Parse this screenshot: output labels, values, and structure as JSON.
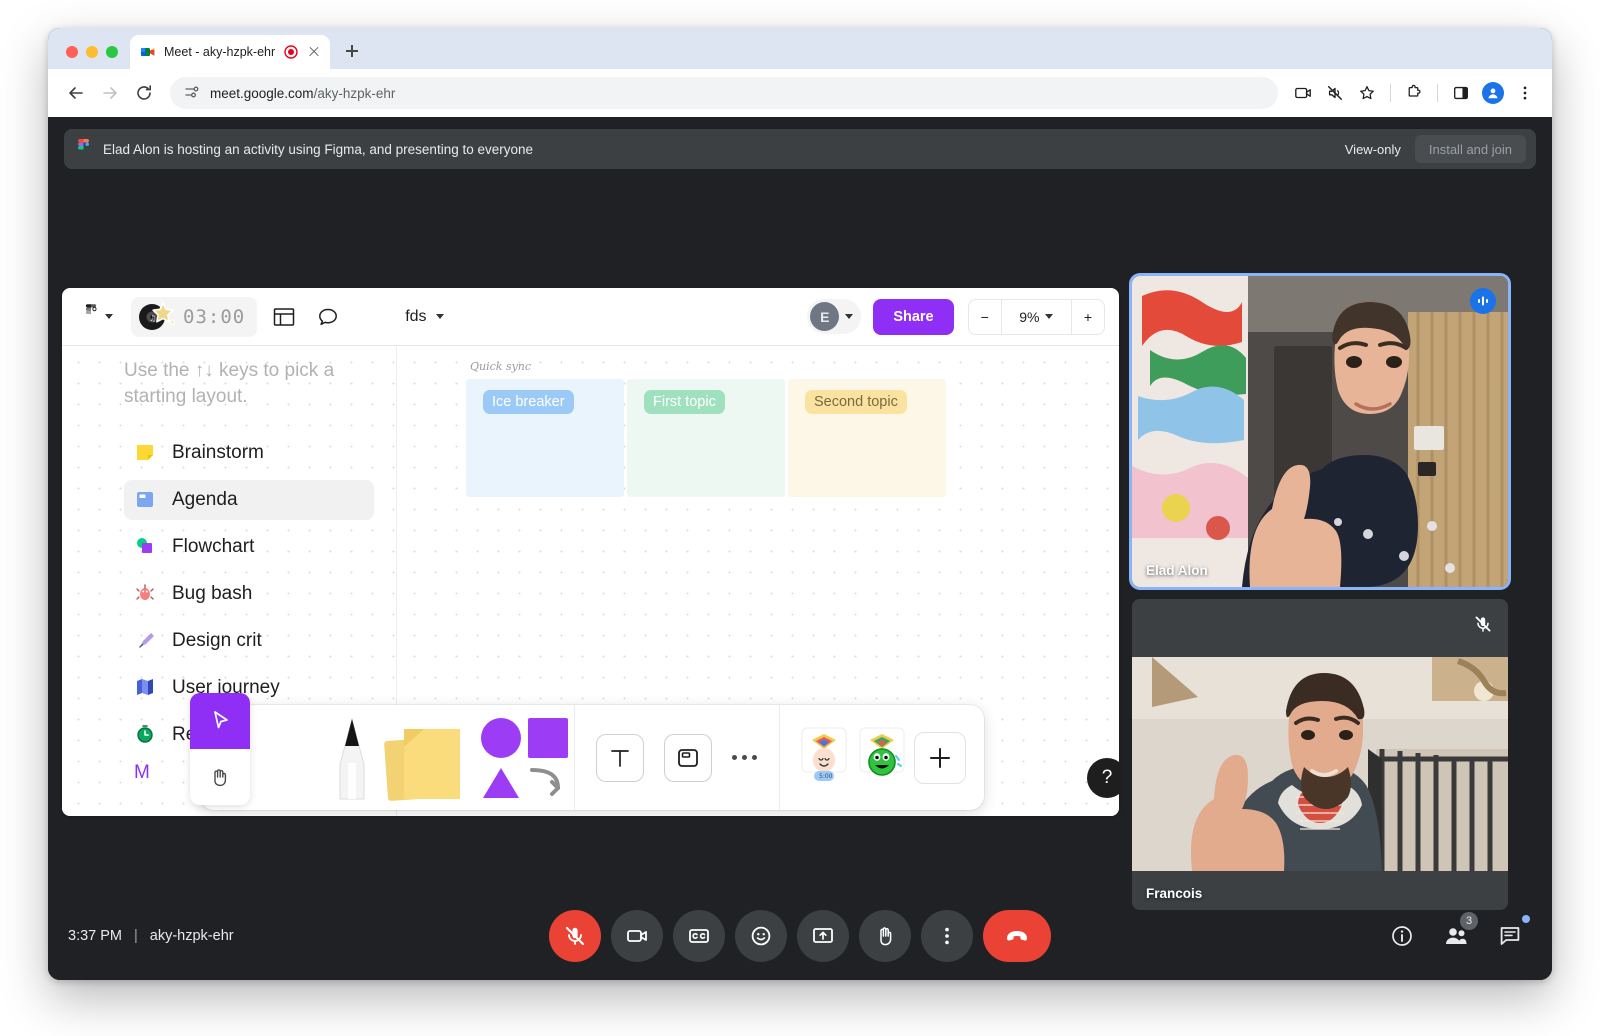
{
  "browser": {
    "tab": {
      "title": "Meet - aky-hzpk-ehr",
      "favicon_name": "google-meet-favicon",
      "recording_indicator_name": "tab-recording-icon"
    },
    "new_tab_label": "+",
    "back_label": "Back",
    "forward_label": "Forward",
    "reload_label": "Reload",
    "omnibox": {
      "host": "meet.google.com",
      "path": "/aky-hzpk-ehr",
      "site_info_icon": "site-settings-icon"
    },
    "toolbar_icons": [
      "screen-share-icon",
      "mute-tab-icon",
      "bookmark-star-icon",
      "extensions-puzzle-icon",
      "side-panel-icon",
      "profile-avatar-icon",
      "chrome-menu-icon"
    ]
  },
  "banner": {
    "app_icon": "figma-logo-icon",
    "message": "Elad Alon is hosting an activity using Figma, and presenting to everyone",
    "view_only_label": "View-only",
    "install_join_label": "Install and join"
  },
  "figma": {
    "menu_icon": "figma-logo-icon",
    "timer": {
      "value": "03:00",
      "icon": "music-star-sticker-icon"
    },
    "layout_icon": "layout-panel-icon",
    "comment_icon": "comment-bubble-icon",
    "doc_name": "fds",
    "presence_initial": "E",
    "share_label": "Share",
    "zoom": {
      "minus_label": "−",
      "level": "9%",
      "plus_label": "+"
    },
    "panel": {
      "hint": "Use the ↑↓ keys to pick a starting layout.",
      "items": [
        {
          "label": "Brainstorm",
          "icon": "sticky-note-emoji",
          "active": false
        },
        {
          "label": "Agenda",
          "icon": "agenda-board-emoji",
          "active": true
        },
        {
          "label": "Flowchart",
          "icon": "flowchart-shapes-emoji",
          "active": false
        },
        {
          "label": "Bug bash",
          "icon": "bug-emoji",
          "active": false
        },
        {
          "label": "Design crit",
          "icon": "pen-nib-emoji",
          "active": false
        },
        {
          "label": "User journey",
          "icon": "map-emoji",
          "active": false
        },
        {
          "label": "Retro",
          "icon": "stopwatch-emoji",
          "active": false
        }
      ],
      "more_label": "M"
    },
    "board": {
      "title": "Quick sync",
      "columns": [
        {
          "chip": "Ice breaker",
          "chip_bg": "#9ccaf7",
          "chip_color": "#ffffff",
          "panel_bg": "#eaf4fd"
        },
        {
          "chip": "First topic",
          "chip_bg": "#9fe0be",
          "chip_color": "#ffffff",
          "panel_bg": "#eef8f2"
        },
        {
          "chip": "Second topic",
          "chip_bg": "#fae3a0",
          "chip_color": "#7a6a3e",
          "panel_bg": "#fdf7e8"
        }
      ]
    },
    "dock": {
      "cursor_tool": "cursor-arrow-icon",
      "hand_tool": "hand-grab-icon",
      "pen_tool": "marker-pen-icon",
      "sticky_tool": "sticky-notes-icon",
      "shapes_tool": "shapes-icon",
      "text_tool": "text-tool-icon",
      "frame_tool": "frame-tool-icon",
      "more_tool": "more-tools-icon",
      "sticker_party_hat": "party-face-sticker-icon",
      "sticker_green": "green-monster-sticker-icon",
      "add_sticker": "add-sticker-icon"
    },
    "help_label": "?"
  },
  "participants": [
    {
      "name": "Elad Alon",
      "badge": "speaking-indicator-icon",
      "badge_type": "speaking",
      "active_speaker": true
    },
    {
      "name": "Francois",
      "badge": "mic-muted-icon",
      "badge_type": "muted",
      "active_speaker": false
    }
  ],
  "meet_bar": {
    "time": "3:37 PM",
    "separator": "|",
    "meeting_code": "aky-hzpk-ehr",
    "controls": [
      {
        "name": "microphone-off-button",
        "icon": "mic-muted-icon",
        "state": "danger"
      },
      {
        "name": "camera-button",
        "icon": "camera-icon",
        "state": "normal"
      },
      {
        "name": "captions-button",
        "icon": "closed-captions-icon",
        "state": "normal"
      },
      {
        "name": "reactions-button",
        "icon": "emoji-smile-icon",
        "state": "normal"
      },
      {
        "name": "present-now-button",
        "icon": "present-screen-icon",
        "state": "normal"
      },
      {
        "name": "raise-hand-button",
        "icon": "raised-hand-icon",
        "state": "normal"
      },
      {
        "name": "more-options-button",
        "icon": "more-vertical-icon",
        "state": "normal"
      },
      {
        "name": "leave-call-button",
        "icon": "end-call-icon",
        "state": "leave"
      }
    ],
    "right_controls": [
      {
        "name": "meeting-details-button",
        "icon": "info-circle-icon",
        "badge": ""
      },
      {
        "name": "participants-button",
        "icon": "people-icon",
        "badge": "3"
      },
      {
        "name": "chat-button",
        "icon": "chat-bubble-icon",
        "badge": ""
      }
    ]
  },
  "colors": {
    "accent_purple": "#8f2ff5",
    "meet_red": "#ea4335",
    "meet_blue": "#1a73e8",
    "active_speaker_border": "#8ab4f8",
    "page_bg": "#202124",
    "banner_bg": "#3c4043"
  }
}
